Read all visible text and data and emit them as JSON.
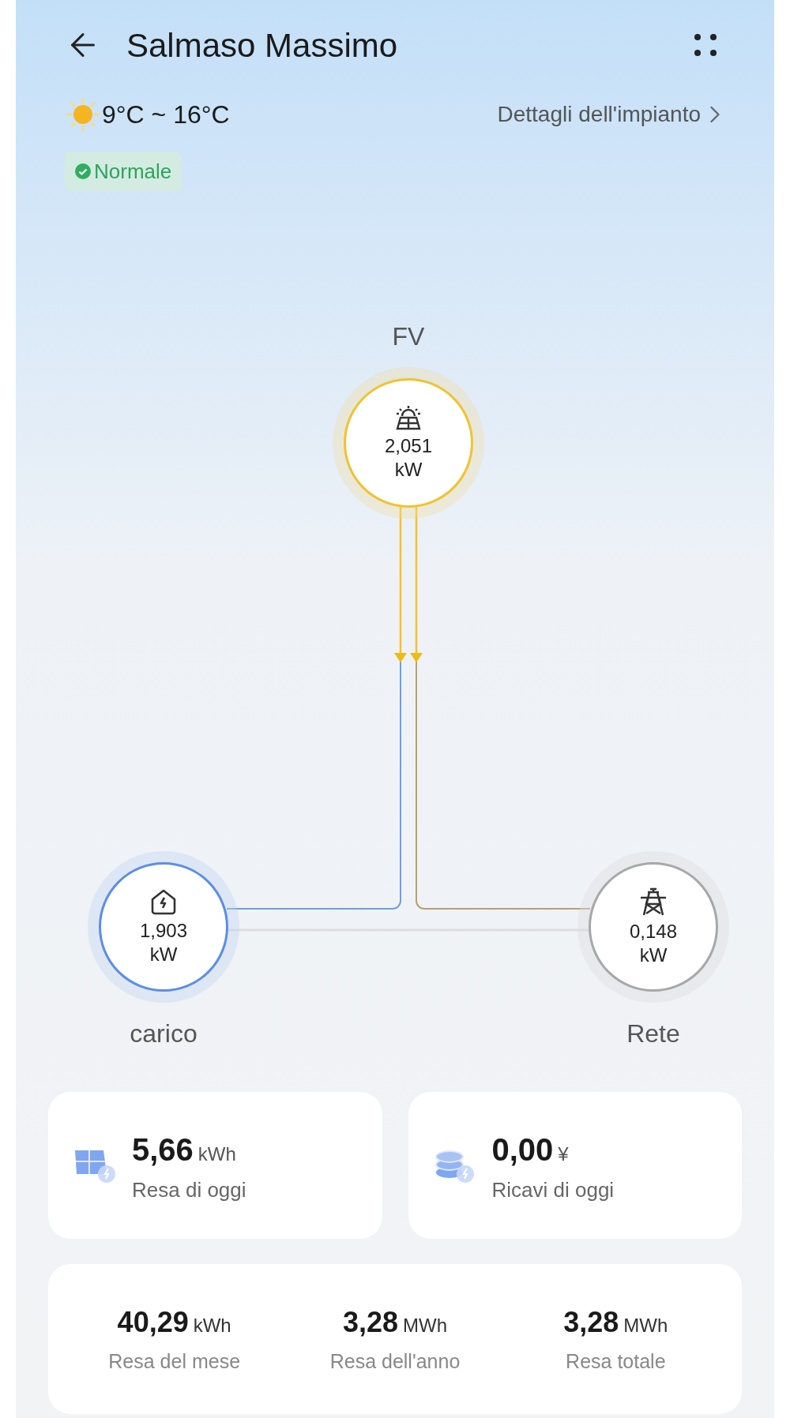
{
  "header": {
    "title": "Salmaso Massimo"
  },
  "weather": {
    "temperature": "9°C ~ 16°C"
  },
  "details_link": {
    "label": "Dettagli dell'impianto"
  },
  "status": {
    "kind": "normal",
    "label": "Normale"
  },
  "flow": {
    "nodes": [
      {
        "kind": "pv",
        "label": "FV",
        "value": "2,051",
        "unit": "kW"
      },
      {
        "kind": "load",
        "label": "carico",
        "value": "1,903",
        "unit": "kW"
      },
      {
        "kind": "grid",
        "label": "Rete",
        "value": "0,148",
        "unit": "kW"
      }
    ]
  },
  "summary_cards": [
    {
      "kind": "yield",
      "value": "5,66",
      "unit": "kWh",
      "label": "Resa di oggi"
    },
    {
      "kind": "revenue",
      "value": "0,00",
      "unit": "¥",
      "label": "Ricavi di oggi"
    }
  ],
  "totals": [
    {
      "value": "40,29",
      "unit": "kWh",
      "label": "Resa del mese"
    },
    {
      "value": "3,28",
      "unit": "MWh",
      "label": "Resa dell'anno"
    },
    {
      "value": "3,28",
      "unit": "MWh",
      "label": "Resa totale"
    }
  ]
}
